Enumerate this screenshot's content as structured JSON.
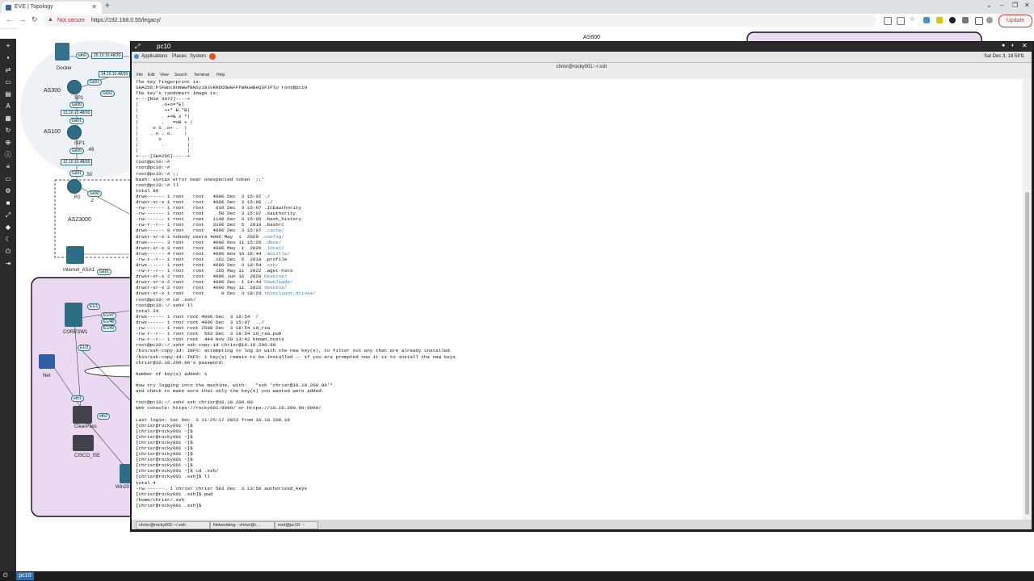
{
  "browser": {
    "tab_title": "EVE | Topology",
    "new_tab": "+",
    "security_label": "Not secure",
    "url": "https://192.168.0.55/legacy/",
    "update_label": "Update"
  },
  "topology": {
    "as_labels": [
      "AS300",
      "AS100",
      "AS23000",
      "AS600"
    ],
    "devices": [
      "Docker",
      "SP1",
      "ISP1",
      "R1",
      "Internet_ASA1",
      "CORESW1",
      "Net",
      "ClearPass",
      "CISCO_ISE",
      "Win20"
    ],
    "networks": [
      "25.10.10.48/30",
      "14.10.10.48/30",
      "13.10.10.48/30",
      "12.10.10.48/30"
    ],
    "interfaces": [
      "eth0",
      "Gi0/1",
      "Gi0/2",
      "Gi0/0",
      "Gi0/1",
      "Gi0/0",
      ".49",
      "Gi0/1",
      ".50",
      "Gi0/0",
      ".2",
      "E1/1",
      "E1/47",
      "E1/48",
      "E1/49",
      "E1/2",
      "eth1",
      "eth2",
      "Gi0/1"
    ]
  },
  "terminal": {
    "window_title": "pc10",
    "gnome_menus": [
      "Applications",
      "Places",
      "System"
    ],
    "clock": "Sat Dec 3, 18:58",
    "title": "chrisr@rocky001:~/.ssh",
    "menu": [
      "File",
      "Edit",
      "View",
      "Search",
      "Terminal",
      "Help"
    ],
    "lines": [
      "The key fingerprint is:",
      "SHA256:PlFWnc8nNWwfBNSy193VKRDOOwGFFfWRuHBeQ3FIPlU root@pc10",
      "The key's randomart image is:",
      "+---[RSA 3072]----+",
      "|        .o+o=*E|",
      "|         ++* B.*B|",
      "|        . +=B X *|",
      "|        .   =oB + |",
      "|     o S .o+ .  |",
      "|    . o . o.    |",
      "|       o         |",
      "|        .        |",
      "|                 |",
      "+----[SHA256]-----+",
      "root@pc10:~#",
      "root@pc10:~#",
      "root@pc10:~# ;;",
      "bash: syntax error near unexpected token `;;'",
      "root@pc10:~# ll",
      "total 80",
      "drwx------ 1 root   root   4096 Dec  3 15:07 ./",
      "drwxr-xr-x 1 root   root   4096 Dec  3 15:06 ../",
      "-rw------- 1 root   root    616 Dec  3 15:07 .ICEauthority",
      "-rw------- 1 root   root     50 Dec  3 15:07 .Xauthority",
      "-rw------- 1 root   root   1140 Dec  3 15:05 .bash_history",
      "-rw-r--r-- 1 root   root   3106 Dec  5  2019 .bashrc",
      "drwx------ 8 root   root   4096 Dec  3 15:07 .cache/",
      "drwxr-xr-x 1 nobody users 4096 May  1  2020 .config/",
      "drwx------ 3 root   root   4096 Nov 11 15:26 .dbus/",
      "drwxr-xr-x 3 root   root   4096 May  1  2020 .local/",
      "drwx------ 4 root   root   4096 Nov 16 18:44 .mozilla/",
      "-rw-r--r-- 1 root   root    161 Dec  5  2019 .profile",
      "drwx------ 1 root   root   4096 Dec  3 18:54 .ssh/",
      "-rw-r--r-- 1 root   root    165 May 11  2022 .wget-hsts",
      "drwxr-xr-x 2 root   root   4096 Jun 16  2020 Desktop/",
      "drwxr-xr-x 2 root   root   4096 Dec  1 14:44 Downloads/",
      "drwxr-xr-x 2 root   root   4096 May 11  2022 desktop/",
      "drwxr-xr-x 1 root   root      0 Dec  3 18:23 thinclient_drives/",
      "root@pc10:~# cd .ssh/",
      "root@pc10:~/.ssh# ll",
      "total 24",
      "drwx------ 1 root root 4096 Dec  3 18:54  /",
      "drwx------ 1 root root 4096 Dec  3 15:07  ../",
      "-rw------- 1 root root 2598 Dec  3 18:54 id_rsa",
      "-rw-r--r-- 1 root root  563 Dec  3 18:54 id_rsa.pub",
      "-rw-r--r-- 1 root root  444 Nov 29 13:42 known_hosts",
      "root@pc10:~/.ssh# ssh-copy-id chrisr@10.10.200.90",
      "/bin/ssh-copy-id: INFO: attempting to log in with the new key(s), to filter out any that are already installed",
      "/bin/ssh-copy-id: INFO: 1 key(s) remain to be installed -- if you are prompted now it is to install the new keys",
      "chrisr@10.10.200.90's password:",
      "",
      "Number of key(s) added: 1",
      "",
      "Now try logging into the machine, with:   \"ssh 'chrisr@10.10.200.90'\"",
      "and check to make sure that only the key(s) you wanted were added.",
      "",
      "root@pc10:~/.ssh# ssh chrisr@10.10.200.90",
      "Web console: https://rocky001:9090/ or https://10.10.200.90:9090/",
      "",
      "Last login: Sat Dec  3 11:25:17 2022 from 10.10.200.10",
      "[chrisr@rocky001 ~]$",
      "[chrisr@rocky001 ~]$",
      "[chrisr@rocky001 ~]$",
      "[chrisr@rocky001 ~]$",
      "[chrisr@rocky001 ~]$",
      "[chrisr@rocky001 ~]$",
      "[chrisr@rocky001 ~]$",
      "[chrisr@rocky001 ~]$",
      "[chrisr@rocky001 ~]$ cd .ssh/",
      "[chrisr@rocky001 .ssh]$ ll",
      "total 4",
      "-rw-------. 1 chrisr chrisr 563 Dec  3 13:56 authorized_keys",
      "[chrisr@rocky001 .ssh]$ pwd",
      "/home/chrisr/.ssh",
      "[chrisr@rocky001 .ssh]$ "
    ],
    "taskbar_items": [
      "chrisr@rocky001:~/.ssh",
      "Networking - chrisr@r...",
      "root@pc10: ~"
    ]
  },
  "taskbar": {
    "active_label": "pc10"
  }
}
